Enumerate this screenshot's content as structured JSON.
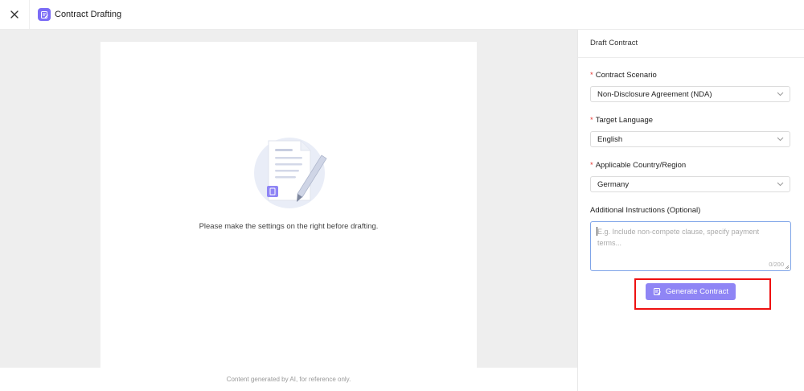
{
  "header": {
    "close_icon": "close-icon",
    "app_icon": "contract-edit-icon",
    "title": "Contract Drafting"
  },
  "main": {
    "empty_message": "Please make the settings on the right before drafting.",
    "illustration": "document-with-pen-illustration",
    "footer_note": "Content generated by AI, for reference only."
  },
  "panel": {
    "title": "Draft Contract",
    "fields": {
      "scenario": {
        "label": "Contract Scenario",
        "required_mark": "*",
        "value": "Non-Disclosure Agreement (NDA)"
      },
      "language": {
        "label": "Target Language",
        "required_mark": "*",
        "value": "English"
      },
      "country": {
        "label": "Applicable Country/Region",
        "required_mark": "*",
        "value": "Germany"
      }
    },
    "instructions": {
      "label": "Additional Instructions (Optional)",
      "placeholder": "E.g. Include non-compete clause, specify payment terms...",
      "value": "",
      "counter": "0/200"
    },
    "generate_label": "Generate Contract"
  },
  "colors": {
    "accent": "#7b6cf6",
    "button": "#8f85f5",
    "required": "#e53935",
    "highlight": "#e11111"
  }
}
